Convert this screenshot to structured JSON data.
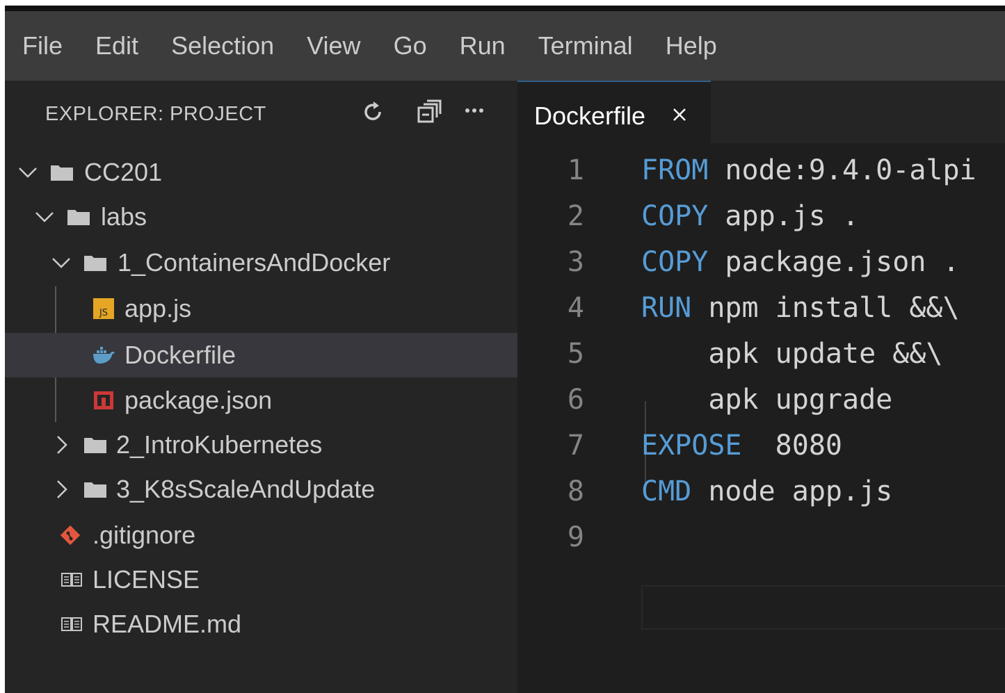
{
  "menubar": {
    "items": [
      "File",
      "Edit",
      "Selection",
      "View",
      "Go",
      "Run",
      "Terminal",
      "Help"
    ]
  },
  "sidebar": {
    "title": "EXPLORER: PROJECT",
    "actions": [
      "refresh-icon",
      "collapse-all-icon",
      "more-icon"
    ],
    "tree": [
      {
        "label": "CC201",
        "type": "folder",
        "expanded": true
      },
      {
        "label": "labs",
        "type": "folder",
        "expanded": true
      },
      {
        "label": "1_ContainersAndDocker",
        "type": "folder",
        "expanded": true
      },
      {
        "label": "app.js",
        "type": "file",
        "icon": "js-icon",
        "icon_text": "JS"
      },
      {
        "label": "Dockerfile",
        "type": "file",
        "icon": "docker-icon",
        "selected": true
      },
      {
        "label": "package.json",
        "type": "file",
        "icon": "npm-icon"
      },
      {
        "label": "2_IntroKubernetes",
        "type": "folder",
        "expanded": false
      },
      {
        "label": "3_K8sScaleAndUpdate",
        "type": "folder",
        "expanded": false
      },
      {
        "label": ".gitignore",
        "type": "file",
        "icon": "git-icon"
      },
      {
        "label": "LICENSE",
        "type": "file",
        "icon": "book-icon"
      },
      {
        "label": "README.md",
        "type": "file",
        "icon": "book-icon"
      }
    ]
  },
  "editor": {
    "tab": {
      "label": "Dockerfile",
      "close": "close-icon"
    },
    "lines": [
      {
        "num": "1",
        "keyword": "FROM",
        "rest": " node:9.4.0-alpi"
      },
      {
        "num": "2",
        "keyword": "COPY",
        "rest": " app.js ."
      },
      {
        "num": "3",
        "keyword": "COPY",
        "rest": " package.json ."
      },
      {
        "num": "4",
        "keyword": "RUN",
        "rest": " npm install &&\\"
      },
      {
        "num": "5",
        "keyword": "",
        "rest": "    apk update &&\\"
      },
      {
        "num": "6",
        "keyword": "",
        "rest": "    apk upgrade"
      },
      {
        "num": "7",
        "keyword": "EXPOSE",
        "rest": "  8080"
      },
      {
        "num": "8",
        "keyword": "CMD",
        "rest": " node app.js"
      },
      {
        "num": "9",
        "keyword": "",
        "rest": ""
      }
    ]
  },
  "colors": {
    "menubar_bg": "#3c3c3c",
    "sidebar_bg": "#252526",
    "editor_bg": "#1e1e1e",
    "keyword": "#569cd6",
    "selection": "#37373d",
    "js_icon": "#e5a624",
    "docker_icon": "#5c9dc8",
    "npm_icon": "#cb3837",
    "git_icon": "#e3573d"
  }
}
